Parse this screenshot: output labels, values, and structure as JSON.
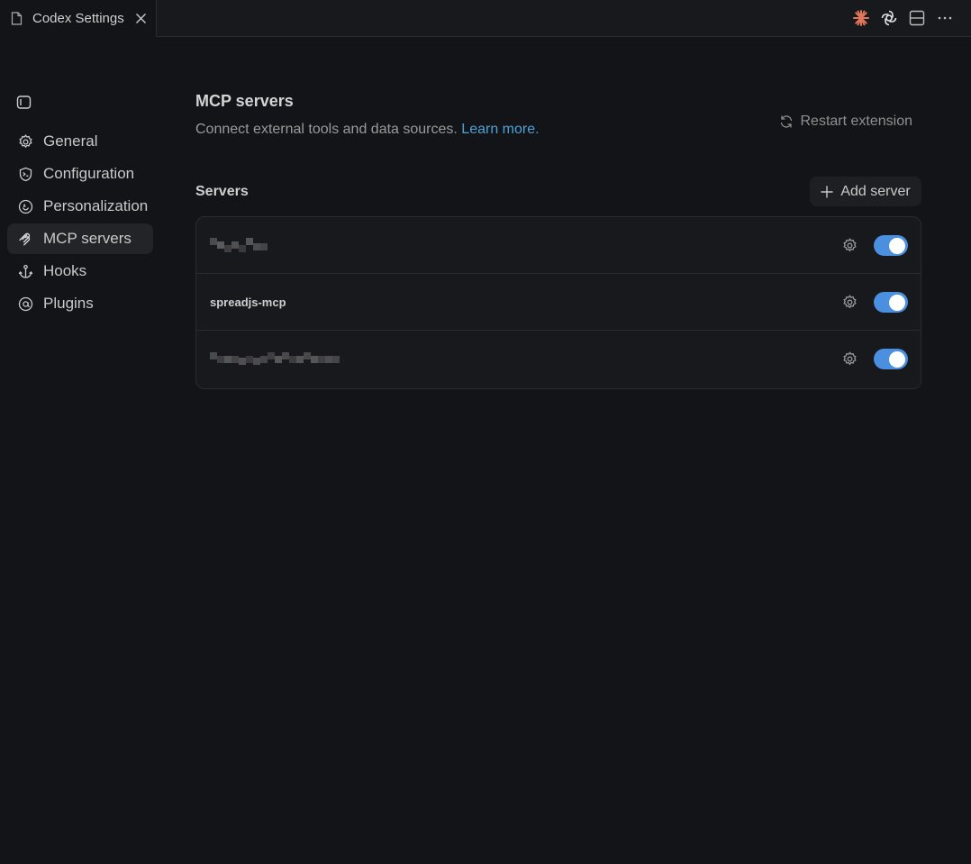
{
  "tab": {
    "title": "Codex Settings"
  },
  "sidebar": {
    "items": [
      {
        "label": "General",
        "icon": "gear-icon",
        "active": false
      },
      {
        "label": "Configuration",
        "icon": "shield-terminal-icon",
        "active": false
      },
      {
        "label": "Personalization",
        "icon": "smile-icon",
        "active": false
      },
      {
        "label": "MCP servers",
        "icon": "mcp-icon",
        "active": true
      },
      {
        "label": "Hooks",
        "icon": "anchor-icon",
        "active": false
      },
      {
        "label": "Plugins",
        "icon": "at-icon",
        "active": false
      }
    ]
  },
  "main": {
    "title": "MCP servers",
    "description": "Connect external tools and data sources.",
    "learn_more": "Learn more.",
    "restart_label": "Restart extension",
    "section_title": "Servers",
    "add_server_label": "Add server",
    "servers": [
      {
        "name": "",
        "obscured": true,
        "enabled": true
      },
      {
        "name": "spreadjs-mcp",
        "obscured": false,
        "enabled": true
      },
      {
        "name": "",
        "obscured": true,
        "enabled": true
      }
    ]
  },
  "colors": {
    "accent": "#4b8fe0",
    "link": "#4ea1d6",
    "background": "#131417"
  }
}
